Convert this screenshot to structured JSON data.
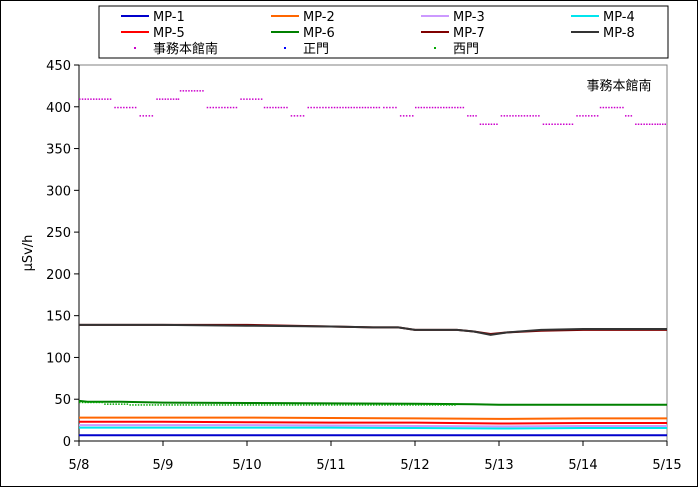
{
  "chart_data": {
    "type": "line",
    "title": "",
    "annotation": "事務本館南",
    "xlabel": "",
    "ylabel": "μSv/h",
    "ylim": [
      0,
      450
    ],
    "yticks": [
      0,
      50,
      100,
      150,
      200,
      250,
      300,
      350,
      400,
      450
    ],
    "xlim": [
      "5/8",
      "5/15"
    ],
    "xticks": [
      "5/8",
      "5/9",
      "5/10",
      "5/11",
      "5/12",
      "5/13",
      "5/14",
      "5/15"
    ],
    "grid": "none",
    "legend_placement": "top",
    "series": [
      {
        "name": "MP-1",
        "color": "#0000cc",
        "style": "line",
        "x": [
          0,
          7
        ],
        "values": [
          7,
          7
        ]
      },
      {
        "name": "MP-2",
        "color": "#ff6600",
        "style": "line",
        "x": [
          0,
          1,
          2,
          3,
          4,
          5,
          6,
          7
        ],
        "values": [
          28,
          28,
          28,
          27.5,
          27,
          26.5,
          27,
          27
        ]
      },
      {
        "name": "MP-3",
        "color": "#cc99ff",
        "style": "line",
        "x": [
          0,
          1,
          2,
          3,
          4,
          5,
          6,
          7
        ],
        "values": [
          19,
          19,
          19,
          18.5,
          18,
          17.5,
          18,
          18
        ]
      },
      {
        "name": "MP-4",
        "color": "#00e5ee",
        "style": "line",
        "x": [
          0,
          1,
          2,
          3,
          4,
          5,
          6,
          7
        ],
        "values": [
          16,
          16,
          16,
          16,
          15.5,
          15,
          15.5,
          15.5
        ]
      },
      {
        "name": "MP-5",
        "color": "#ff0000",
        "style": "line",
        "x": [
          0,
          1,
          2,
          3,
          4,
          5,
          6,
          7
        ],
        "values": [
          23,
          23,
          22.5,
          22,
          22,
          21,
          21.5,
          21.5
        ]
      },
      {
        "name": "MP-6",
        "color": "#008000",
        "style": "line",
        "x": [
          0,
          0.1,
          0.5,
          1,
          2,
          3,
          4,
          4.7,
          5,
          6,
          7
        ],
        "values": [
          48,
          47,
          47,
          46,
          45.5,
          45,
          44.5,
          44,
          43.5,
          43.5,
          43.5
        ]
      },
      {
        "name": "MP-7",
        "color": "#800000",
        "style": "line",
        "x": [
          0,
          1,
          2,
          3,
          3.5,
          3.8,
          4,
          4.5,
          4.7,
          4.9,
          5.1,
          5.5,
          6,
          7
        ],
        "values": [
          139,
          139,
          139,
          137,
          136,
          136,
          133,
          133,
          131,
          128,
          130,
          132,
          133,
          133
        ]
      },
      {
        "name": "MP-8",
        "color": "#333333",
        "style": "line",
        "x": [
          0,
          1,
          2,
          3,
          3.5,
          3.8,
          4,
          4.5,
          4.7,
          4.9,
          5.1,
          5.5,
          6,
          7
        ],
        "values": [
          139,
          139,
          138,
          137,
          136,
          136,
          133,
          133,
          131,
          127,
          130,
          133,
          134,
          134
        ]
      },
      {
        "name": "事務本館南",
        "color": "#cc00cc",
        "style": "dots",
        "x": [
          0,
          0.4,
          0.42,
          0.7,
          0.72,
          0.9,
          0.92,
          1.15,
          1.2,
          1.5,
          1.52,
          1.9,
          1.92,
          2.2,
          2.5,
          2.52,
          2.7,
          2.72,
          3.0,
          3.3,
          3.6,
          3.62,
          3.8,
          3.82,
          4.0,
          4.3,
          4.6,
          4.62,
          4.75,
          4.77,
          5.0,
          5.02,
          5.5,
          5.52,
          5.9,
          5.92,
          6.2,
          6.5,
          6.6,
          6.62,
          6.85,
          7.0
        ],
        "values": [
          410,
          410,
          400,
          400,
          390,
          390,
          410,
          410,
          420,
          410,
          400,
          400,
          410,
          400,
          400,
          390,
          390,
          400,
          400,
          400,
          410,
          400,
          400,
          390,
          400,
          400,
          390,
          390,
          390,
          380,
          380,
          390,
          390,
          380,
          380,
          390,
          400,
          390,
          390,
          380,
          380,
          390
        ]
      },
      {
        "name": "正門",
        "color": "#0000ff",
        "style": "dots",
        "x": [],
        "values": []
      },
      {
        "name": "西門",
        "color": "#00aa00",
        "style": "dots",
        "x": [
          0,
          0.3,
          0.6,
          1,
          1.5,
          2,
          2.5,
          3,
          3.5,
          4,
          4.5
        ],
        "values": [
          47,
          45,
          44,
          44,
          44,
          44,
          44,
          44,
          44,
          44,
          44
        ]
      }
    ]
  }
}
